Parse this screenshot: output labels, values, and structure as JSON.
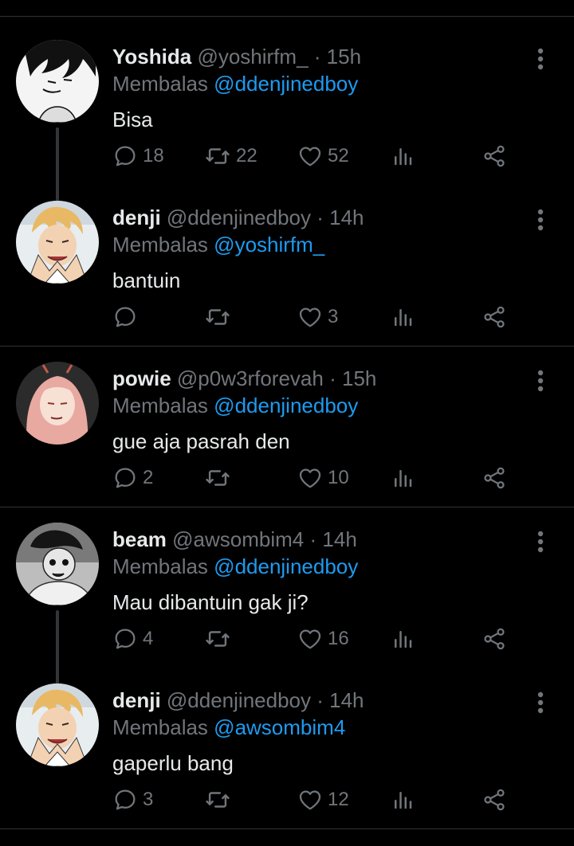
{
  "colors": {
    "background": "#000000",
    "text_primary": "#e7e9ea",
    "text_secondary": "#71767b",
    "accent": "#1d9bf0",
    "divider": "#2f3336"
  },
  "reply_prefix": "Membalas",
  "separator": "·",
  "tweets": [
    {
      "name": "Yoshida",
      "handle": "@yoshirfm_",
      "time": "15h",
      "reply_to": "@ddenjinedboy",
      "text": "Bisa",
      "replies": "18",
      "retweets": "22",
      "likes": "52",
      "avatar_icon": "avatar-yoshida"
    },
    {
      "name": "denji",
      "handle": "@ddenjinedboy",
      "time": "14h",
      "reply_to": "@yoshirfm_",
      "text": "bantuin",
      "replies": "",
      "retweets": "",
      "likes": "3",
      "avatar_icon": "avatar-denji"
    },
    {
      "name": "powie",
      "handle": "@p0w3rforevah",
      "time": "15h",
      "reply_to": "@ddenjinedboy",
      "text": "gue aja pasrah den",
      "replies": "2",
      "retweets": "",
      "likes": "10",
      "avatar_icon": "avatar-powie"
    },
    {
      "name": "beam",
      "handle": "@awsombim4",
      "time": "14h",
      "reply_to": "@ddenjinedboy",
      "text": "Mau dibantuin gak ji?",
      "replies": "4",
      "retweets": "",
      "likes": "16",
      "avatar_icon": "avatar-beam"
    },
    {
      "name": "denji",
      "handle": "@ddenjinedboy",
      "time": "14h",
      "reply_to": "@awsombim4",
      "text": "gaperlu bang",
      "replies": "3",
      "retweets": "",
      "likes": "12",
      "avatar_icon": "avatar-denji"
    }
  ]
}
